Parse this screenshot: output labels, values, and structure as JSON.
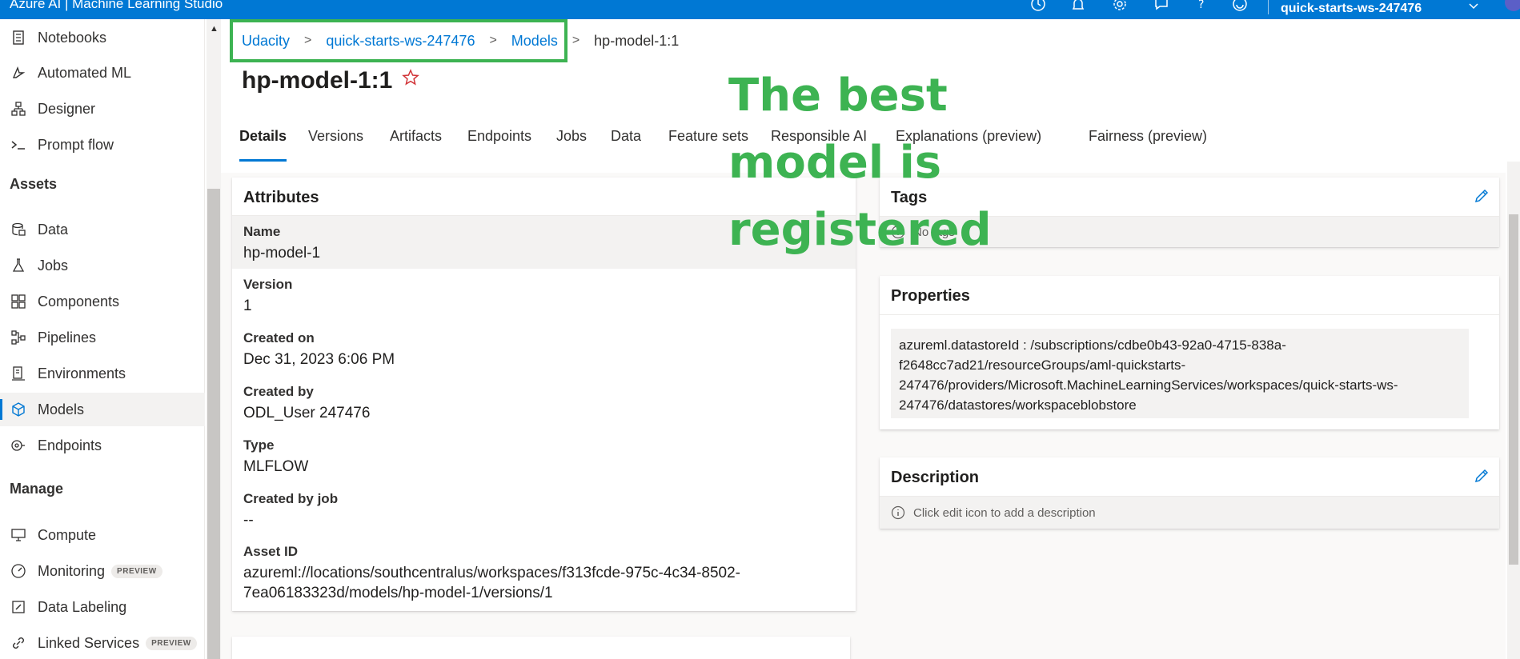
{
  "topbar": {
    "app_title": "Azure AI | Machine Learning Studio",
    "workspace": "quick-starts-ws-247476",
    "icons": [
      "clock-icon",
      "bell-icon",
      "gear-icon",
      "feedback-icon",
      "help-icon",
      "smiley-icon",
      "chevron-down-icon"
    ]
  },
  "sidebar": {
    "items": [
      {
        "label": "Notebooks",
        "icon": "notebook-icon"
      },
      {
        "label": "Automated ML",
        "icon": "automl-icon"
      },
      {
        "label": "Designer",
        "icon": "designer-icon"
      },
      {
        "label": "Prompt flow",
        "icon": "prompt-icon"
      }
    ],
    "assets_heading": "Assets",
    "assets_items": [
      {
        "label": "Data",
        "icon": "data-icon"
      },
      {
        "label": "Jobs",
        "icon": "flask-icon"
      },
      {
        "label": "Components",
        "icon": "components-icon"
      },
      {
        "label": "Pipelines",
        "icon": "pipeline-icon"
      },
      {
        "label": "Environments",
        "icon": "environment-icon"
      },
      {
        "label": "Models",
        "icon": "cube-icon"
      },
      {
        "label": "Endpoints",
        "icon": "endpoint-icon"
      }
    ],
    "manage_heading": "Manage",
    "manage_items": [
      {
        "label": "Compute",
        "icon": "compute-icon"
      },
      {
        "label": "Monitoring",
        "icon": "gauge-icon",
        "badge": "PREVIEW"
      },
      {
        "label": "Data Labeling",
        "icon": "label-icon"
      },
      {
        "label": "Linked Services",
        "icon": "link-icon",
        "badge": "PREVIEW"
      }
    ]
  },
  "breadcrumb": {
    "items": [
      "Udacity",
      "quick-starts-ws-247476",
      "Models"
    ],
    "current": "hp-model-1:1"
  },
  "page": {
    "title": "hp-model-1:1",
    "tabs": [
      "Details",
      "Versions",
      "Artifacts",
      "Endpoints",
      "Jobs",
      "Data",
      "Feature sets",
      "Responsible AI",
      "Explanations (preview)",
      "Fairness (preview)"
    ],
    "active_tab": "Details"
  },
  "attributes": {
    "title": "Attributes",
    "rows": [
      {
        "label": "Name",
        "value": "hp-model-1"
      },
      {
        "label": "Version",
        "value": "1"
      },
      {
        "label": "Created on",
        "value": "Dec 31, 2023 6:06 PM"
      },
      {
        "label": "Created by",
        "value": "ODL_User 247476"
      },
      {
        "label": "Type",
        "value": "MLFLOW"
      },
      {
        "label": "Created by job",
        "value": "--"
      },
      {
        "label": "Asset ID",
        "value_lines": [
          "azureml://locations/southcentralus/workspaces/f313fcde-975c-4c34-8502-",
          "7ea06183323d/models/hp-model-1/versions/1"
        ]
      }
    ]
  },
  "tags": {
    "title": "Tags",
    "empty_text": "No tags"
  },
  "properties": {
    "title": "Properties",
    "lines": [
      "azureml.datastoreId : /subscriptions/cdbe0b43-92a0-4715-838a-",
      "f2648cc7ad21/resourceGroups/aml-quickstarts-",
      "247476/providers/Microsoft.MachineLearningServices/workspaces/quick-starts-ws-",
      "247476/datastores/workspaceblobstore"
    ]
  },
  "description": {
    "title": "Description",
    "empty_text": "Click edit icon to add a description"
  },
  "annotation": {
    "lines": [
      "The best",
      "model is",
      "registered"
    ],
    "color": "#3db352"
  },
  "colors": {
    "accent": "#0078d4",
    "highlight": "#3db352",
    "star": "#d13438"
  }
}
